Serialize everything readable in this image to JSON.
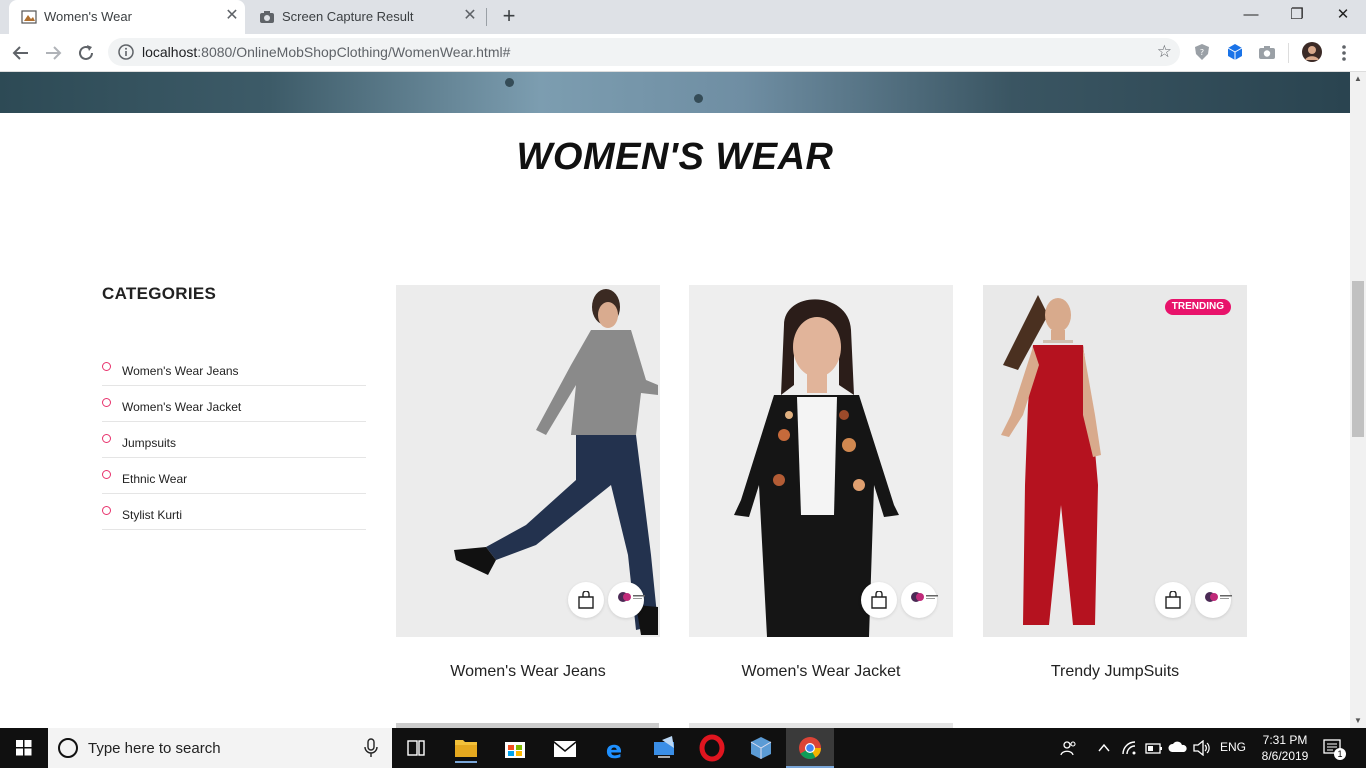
{
  "browser": {
    "tabs": [
      {
        "title": "Women's Wear",
        "active": true
      },
      {
        "title": "Screen Capture Result",
        "active": false
      }
    ],
    "url_host": "localhost",
    "url_path": ":8080/OnlineMobShopClothing/WomenWear.html#"
  },
  "page": {
    "title": "WOMEN'S WEAR",
    "sidebar": {
      "heading": "CATEGORIES",
      "items": [
        {
          "label": "Women's Wear Jeans"
        },
        {
          "label": "Women's Wear Jacket"
        },
        {
          "label": "Jumpsuits"
        },
        {
          "label": "Ethnic Wear"
        },
        {
          "label": "Stylist Kurti"
        }
      ]
    },
    "products": [
      {
        "name": "Women's Wear Jeans",
        "badge": ""
      },
      {
        "name": "Women's Wear Jacket",
        "badge": ""
      },
      {
        "name": "Trendy JumpSuits",
        "badge": "TRENDING"
      }
    ],
    "accent_color": "#e8136b"
  },
  "taskbar": {
    "search_placeholder": "Type here to search",
    "language": "ENG",
    "time": "7:31 PM",
    "date": "8/6/2019",
    "notification_count": "1"
  }
}
